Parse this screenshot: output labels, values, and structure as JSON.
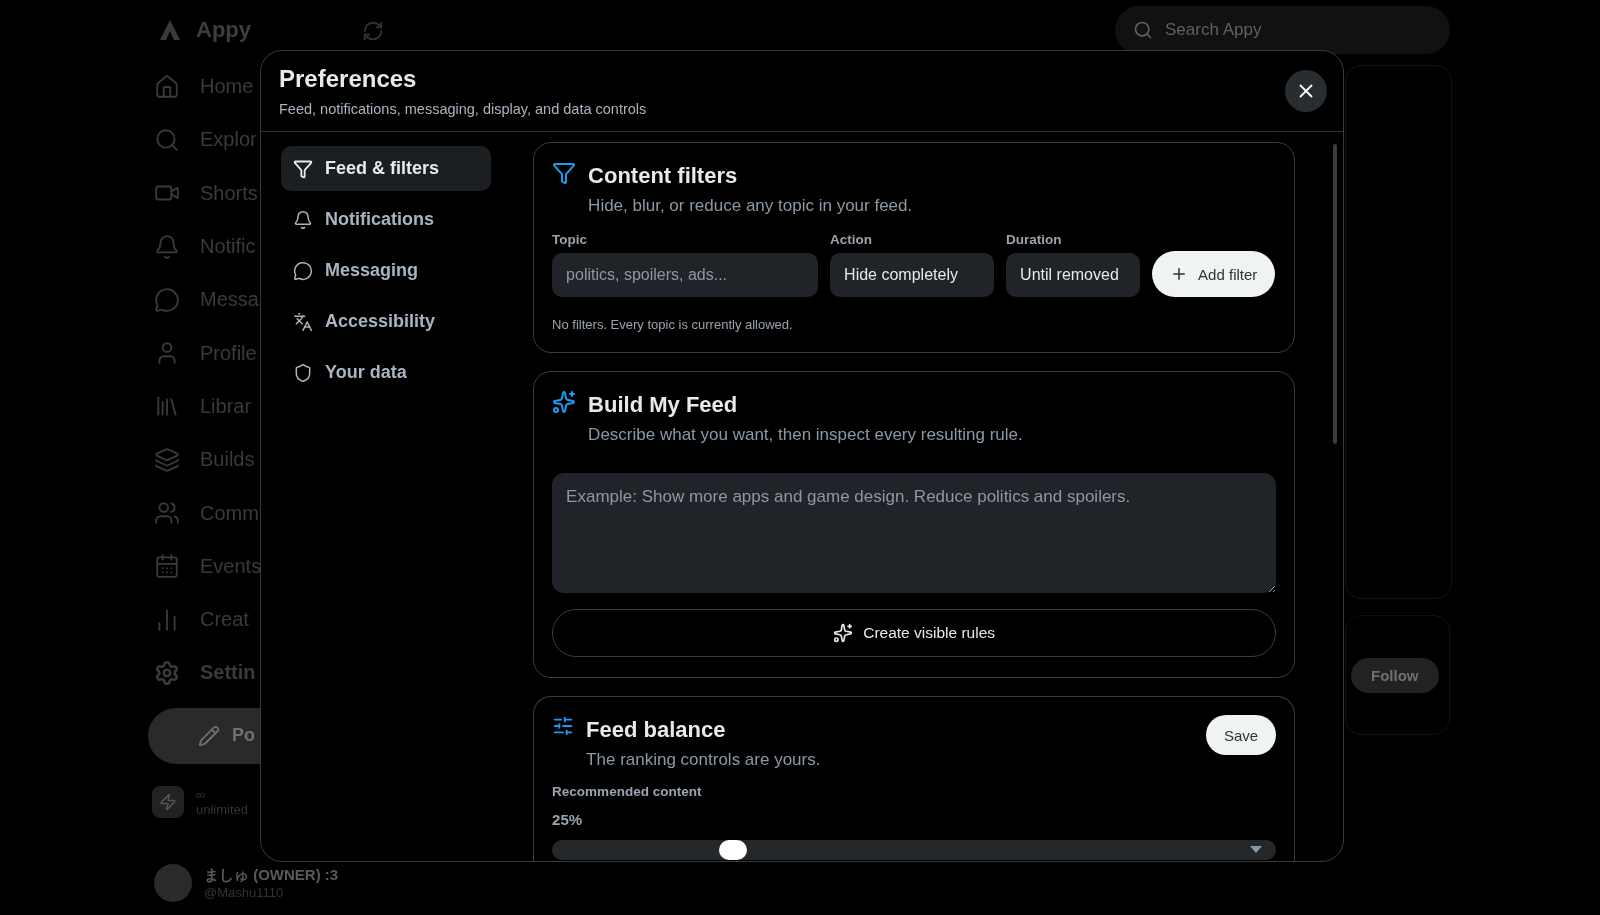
{
  "background": {
    "brand": "Appy",
    "nav": [
      {
        "label": "Home",
        "selected": false
      },
      {
        "label": "Explor",
        "selected": false
      },
      {
        "label": "Shorts",
        "selected": false
      },
      {
        "label": "Notific",
        "selected": false
      },
      {
        "label": "Messa",
        "selected": false
      },
      {
        "label": "Profile",
        "selected": false
      },
      {
        "label": "Librar",
        "selected": false
      },
      {
        "label": "Builds",
        "selected": false
      },
      {
        "label": "Comm",
        "selected": false
      },
      {
        "label": "Events",
        "selected": false
      },
      {
        "label": "Creat",
        "selected": false
      },
      {
        "label": "Settin",
        "selected": true
      }
    ],
    "post_label": "Po",
    "plan": {
      "symbol": "∞",
      "label": "unlimited"
    },
    "user": {
      "name": "ましゅ (OWNER) :3",
      "handle": "@Mashu1110"
    },
    "search": {
      "placeholder": "Search Appy"
    },
    "follow_label": "Follow"
  },
  "dialog": {
    "title": "Preferences",
    "subtitle": "Feed, notifications, messaging, display, and data controls",
    "tabs": [
      {
        "label": "Feed & filters",
        "selected": true
      },
      {
        "label": "Notifications",
        "selected": false
      },
      {
        "label": "Messaging",
        "selected": false
      },
      {
        "label": "Accessibility",
        "selected": false
      },
      {
        "label": "Your data",
        "selected": false
      }
    ],
    "content_filters": {
      "title": "Content filters",
      "subtitle": "Hide, blur, or reduce any topic in your feed.",
      "topic": {
        "label": "Topic",
        "placeholder": "politics, spoilers, ads..."
      },
      "action": {
        "label": "Action",
        "value": "Hide completely"
      },
      "duration": {
        "label": "Duration",
        "value": "Until removed"
      },
      "add_button": "Add filter",
      "note": "No filters. Every topic is currently allowed."
    },
    "build_feed": {
      "title": "Build My Feed",
      "subtitle": "Describe what you want, then inspect every resulting rule.",
      "placeholder": "Example: Show more apps and game design. Reduce politics and spoilers.",
      "button": "Create visible rules"
    },
    "feed_balance": {
      "title": "Feed balance",
      "subtitle": "The ranking controls are yours.",
      "save": "Save",
      "slider": {
        "label": "Recommended content",
        "reading": "25%",
        "level": 0.25
      }
    }
  }
}
